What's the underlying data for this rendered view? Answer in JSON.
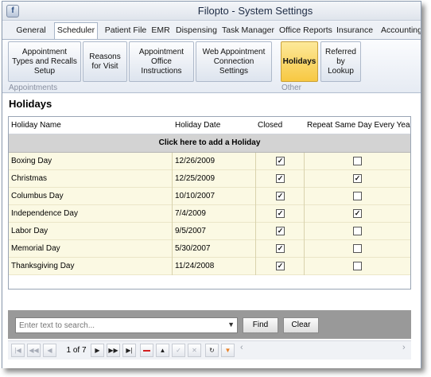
{
  "window": {
    "title": "Filopto - System Settings"
  },
  "tabs": [
    {
      "label": "General"
    },
    {
      "label": "Scheduler",
      "active": true
    },
    {
      "label": "Patient File"
    },
    {
      "label": "EMR"
    },
    {
      "label": "Dispensing"
    },
    {
      "label": "Task Manager"
    },
    {
      "label": "Office Reports"
    },
    {
      "label": "Insurance"
    },
    {
      "label": "Accounting"
    }
  ],
  "ribbon": {
    "buttons": [
      {
        "label": "Appointment Types and Recalls Setup"
      },
      {
        "label": "Reasons for Visit"
      },
      {
        "label": "Appointment Office Instructions"
      },
      {
        "label": "Web Appointment Connection Settings"
      },
      {
        "label": "Holidays",
        "selected": true
      },
      {
        "label": "Referred by Lookup"
      }
    ],
    "groups": {
      "appointments": "Appointments",
      "other": "Other"
    }
  },
  "page": {
    "title": "Holidays"
  },
  "grid": {
    "columns": [
      "Holiday Name",
      "Holiday Date",
      "Closed",
      "Repeat Same Day Every Year"
    ],
    "add_row_label": "Click here to add a Holiday",
    "rows": [
      {
        "name": "Boxing Day",
        "date": "12/26/2009",
        "closed": true,
        "repeat": false
      },
      {
        "name": "Christmas",
        "date": "12/25/2009",
        "closed": true,
        "repeat": true
      },
      {
        "name": "Columbus Day",
        "date": "10/10/2007",
        "closed": true,
        "repeat": false
      },
      {
        "name": "Independence Day",
        "date": "7/4/2009",
        "closed": true,
        "repeat": true
      },
      {
        "name": "Labor Day",
        "date": "9/5/2007",
        "closed": true,
        "repeat": false
      },
      {
        "name": "Memorial Day",
        "date": "5/30/2007",
        "closed": true,
        "repeat": false
      },
      {
        "name": "Thanksgiving Day",
        "date": "11/24/2008",
        "closed": true,
        "repeat": false
      }
    ]
  },
  "search": {
    "placeholder": "Enter text to search...",
    "find_label": "Find",
    "clear_label": "Clear"
  },
  "navigator": {
    "page_indicator": "1 of 7",
    "colors": {
      "remove": "#d22020",
      "filter": "#e8822a"
    }
  }
}
